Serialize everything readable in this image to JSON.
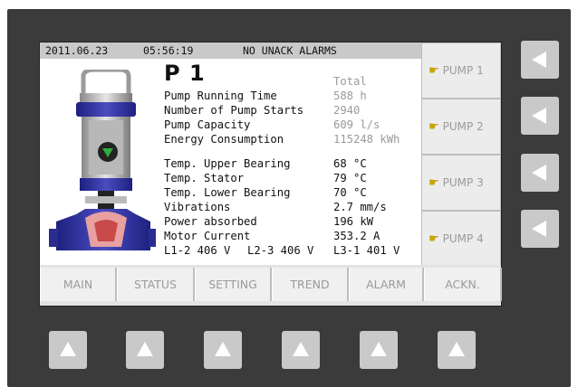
{
  "status": {
    "date": "2011.06.23",
    "time": "05:56:19",
    "alarm": "NO UNACK ALARMS"
  },
  "pump": {
    "title": "P 1",
    "column_header": "Total",
    "totals": [
      {
        "label": "Pump Running Time",
        "value": "588 h"
      },
      {
        "label": "Number of Pump Starts",
        "value": "2940"
      },
      {
        "label": "Pump Capacity",
        "value": "609 l/s"
      },
      {
        "label": "Energy Consumption",
        "value": "115248 kWh"
      }
    ],
    "measurements": [
      {
        "label": "Temp. Upper Bearing",
        "value": "68 °C"
      },
      {
        "label": "Temp. Stator",
        "value": "79 °C"
      },
      {
        "label": "Temp. Lower Bearing",
        "value": "70 °C"
      },
      {
        "label": "Vibrations",
        "value": "2.7 mm/s"
      },
      {
        "label": "Power absorbed",
        "value": "196 kW"
      },
      {
        "label": "Motor Current",
        "value": "353.2 A"
      }
    ],
    "voltages": {
      "l12": "L1-2 406 V",
      "l23": "L2-3 406 V",
      "l31": "L3-1 401 V"
    },
    "running": true
  },
  "pump_buttons": [
    "PUMP 1",
    "PUMP 2",
    "PUMP 3",
    "PUMP 4"
  ],
  "nav": [
    "MAIN",
    "STATUS",
    "SETTING",
    "TREND",
    "ALARM",
    "ACKN."
  ],
  "colors": {
    "panel": "#3b3b3b",
    "pump_body": "#3d3fa8",
    "running_indicator": "#2fae3b",
    "softkey": "#c9c9c9"
  }
}
